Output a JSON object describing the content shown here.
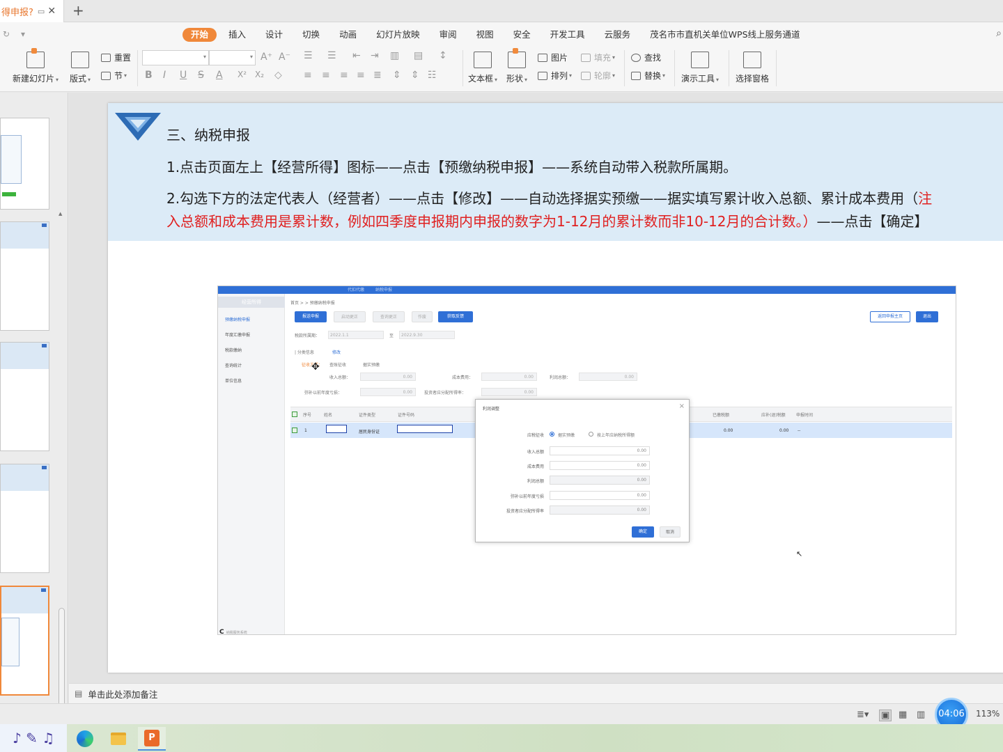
{
  "tabbar": {
    "doc_title": "得申报?",
    "add_tab": "+"
  },
  "menu": [
    "开始",
    "插入",
    "设计",
    "切换",
    "动画",
    "幻灯片放映",
    "审阅",
    "视图",
    "安全",
    "开发工具",
    "云服务",
    "茂名市市直机关单位WPS线上服务通道"
  ],
  "ribbon": {
    "new_slide": "新建幻灯片",
    "layout": "版式",
    "reset": "重置",
    "section": "节",
    "textbox": "文本框",
    "shape": "形状",
    "picture": "图片",
    "arrange": "排列",
    "fill": "填充",
    "outline": "轮廓",
    "find": "查找",
    "replace": "替换",
    "present_tools": "演示工具",
    "select_pane": "选择窗格",
    "font_grow": "A⁺",
    "font_shrink": "A⁻",
    "bold": "B",
    "italic": "I",
    "underline": "U",
    "strike": "S",
    "fontcolor": "A",
    "superscript": "X²",
    "subscript": "X₂"
  },
  "slide": {
    "title": "三、纳税申报",
    "p1": "1.点击页面左上【经营所得】图标——点击【预缴纳税申报】——系统自动带入税款所属期。",
    "p2_black": "2.勾选下方的法定代表人（经营者）——点击【修改】——自动选择据实预缴——据实填写累计收入总额、累计成本费用（",
    "p2_red_tail": "注",
    "p3_red": "入总额和成本费用是累计数，例如四季度申报期内申报的数字为1-12月的累计数而非10-12月的合计数。）",
    "p3_black": "——点击【确定】"
  },
  "screenshot": {
    "side_header": "经营所得",
    "side_items": [
      "预缴纳税申报",
      "年度汇缴申报",
      "税款缴纳",
      "查询统计",
      "单位信息"
    ],
    "foot_logo": "C",
    "foot_text": "纳税服务系统",
    "top_tabs": [
      "代扣代缴",
      "纳税申报"
    ],
    "breadcrumb": "首页 > > 预缴纳税申报",
    "buttons": [
      "报送申报",
      "启动更正",
      "查询更正",
      "作废",
      "获取反馈"
    ],
    "btn_right_1": "返回申报主页",
    "btn_right_2": "退出",
    "period_label": "税款所属期：",
    "period_from": "2022.1.1",
    "period_to_label": "至",
    "period_to": "2022.9.30",
    "section_label": "| 分类信息",
    "edit_link": "修改",
    "levy_label": "征收方式：",
    "levy_value": "查账征收",
    "levy_value2": "据实预缴",
    "income_label": "收入总额：",
    "income_val": "0.00",
    "cost_label": "成本费用：",
    "cost_val": "0.00",
    "profit_label": "利润总额：",
    "profit_val": "0.00",
    "loss_label": "弥补以前年度亏损：",
    "loss_val": "0.00",
    "adjust_label": "投资者应分配所得率：",
    "adjust_val": "0.00",
    "table_headers": [
      "序号",
      "姓名",
      "证件类型",
      "证件号码",
      "已缴税额",
      "应补(退)税额",
      "申报时间"
    ],
    "row": {
      "no": "1",
      "id_type": "居民身份证",
      "paid": "0.00",
      "due": "0.00",
      "time": "--"
    },
    "modal": {
      "title": "利润调整",
      "close": "×",
      "levy_label": "应税征收",
      "opt1": "据实预缴",
      "opt2": "按上年应纳税所得额",
      "fields": [
        {
          "label": "收入总额",
          "value": "0.00"
        },
        {
          "label": "成本费用",
          "value": "0.00"
        },
        {
          "label": "利润总额",
          "value": "0.00"
        },
        {
          "label": "弥补以前年度亏损",
          "value": "0.00"
        },
        {
          "label": "投资者应分配所得率",
          "value": "0.00"
        }
      ],
      "ok": "确定",
      "cancel": "取消"
    }
  },
  "notes": {
    "placeholder": "单击此处添加备注"
  },
  "status": {
    "timer": "04:06",
    "zoom": "113%"
  },
  "taskbar": {
    "wps_glyph": "P"
  }
}
